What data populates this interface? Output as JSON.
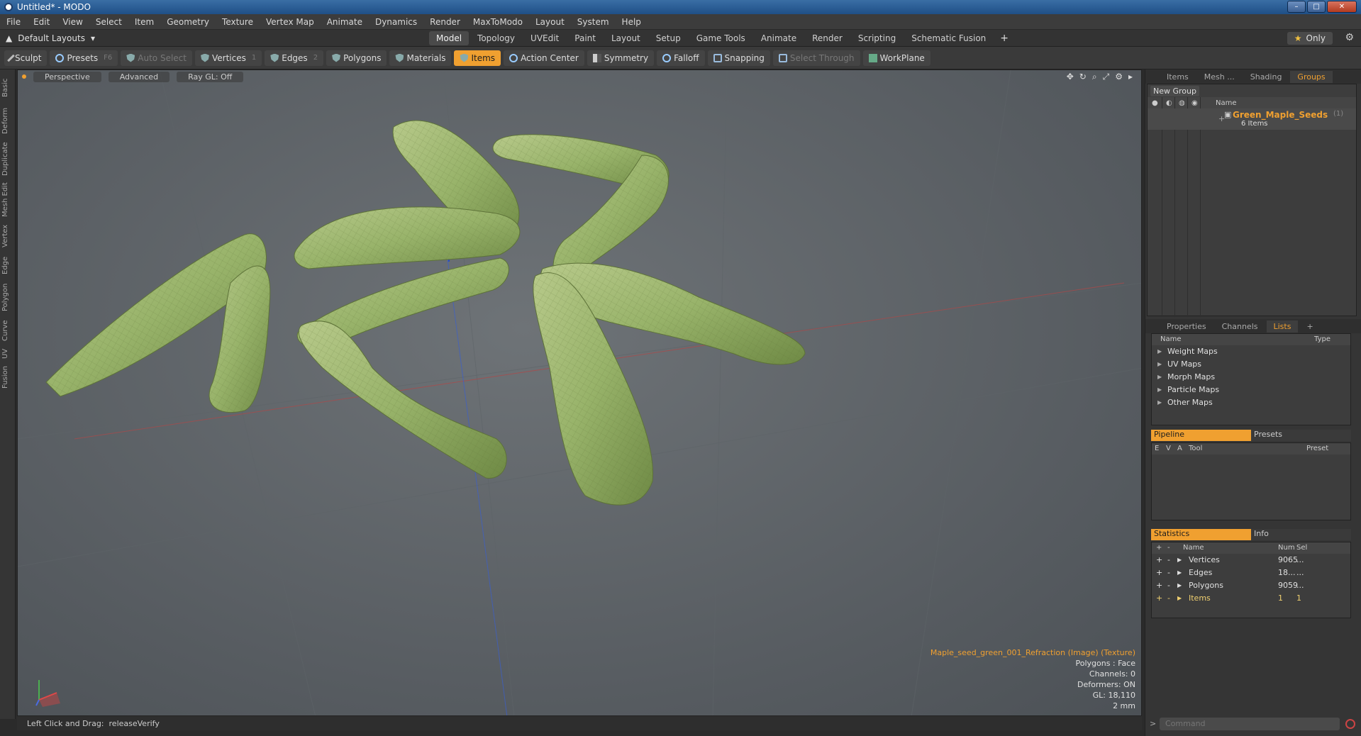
{
  "window": {
    "title": "Untitled* - MODO"
  },
  "menu": [
    "File",
    "Edit",
    "View",
    "Select",
    "Item",
    "Geometry",
    "Texture",
    "Vertex Map",
    "Animate",
    "Dynamics",
    "Render",
    "MaxToModo",
    "Layout",
    "System",
    "Help"
  ],
  "layout": {
    "dropdown": "Default Layouts",
    "tabs": [
      "Model",
      "Topology",
      "UVEdit",
      "Paint",
      "Layout",
      "Setup",
      "Game Tools",
      "Animate",
      "Render",
      "Scripting",
      "Schematic Fusion"
    ],
    "active_tab": "Model",
    "only_label": "Only"
  },
  "toolbar": {
    "sculpt": "Sculpt",
    "presets": "Presets",
    "presets_key": "F6",
    "auto_select": "Auto Select",
    "vertices": "Vertices",
    "vertices_key": "1",
    "edges": "Edges",
    "edges_key": "2",
    "polygons": "Polygons",
    "materials": "Materials",
    "items": "Items",
    "action_center": "Action Center",
    "symmetry": "Symmetry",
    "falloff": "Falloff",
    "snapping": "Snapping",
    "select_through": "Select Through",
    "workplane": "WorkPlane"
  },
  "left_tabs": [
    "Basic",
    "Deform",
    "Duplicate",
    "Mesh Edit",
    "Vertex",
    "Edge",
    "Polygon",
    "Curve",
    "UV",
    "Fusion"
  ],
  "viewport": {
    "view": "Perspective",
    "advanced": "Advanced",
    "raygl": "Ray GL: Off",
    "info": {
      "texture": "Maple_seed_green_001_Refraction (Image) (Texture)",
      "polygons": "Polygons : Face",
      "channels": "Channels: 0",
      "deformers": "Deformers: ON",
      "gl": "GL: 18,110",
      "scale": "2 mm"
    }
  },
  "status": {
    "left": "Left Click and Drag:",
    "action": "releaseVerify"
  },
  "right_panel": {
    "top_tabs": [
      "Items",
      "Mesh ...",
      "Shading",
      "Groups"
    ],
    "active_top_tab": "Groups",
    "new_group": "New Group",
    "name_header": "Name",
    "group_name": "Green_Maple_Seeds",
    "group_count_dim": "(1)",
    "group_items": "6 Items",
    "props_tabs": [
      "Properties",
      "Channels",
      "Lists"
    ],
    "active_props_tab": "Lists",
    "lists_header": {
      "name": "Name",
      "type": "Type"
    },
    "lists": [
      "Weight Maps",
      "UV Maps",
      "Morph Maps",
      "Particle Maps",
      "Other Maps"
    ],
    "pipeline_tab": "Pipeline",
    "presets_tab": "Presets",
    "pipeline_header": {
      "e": "E",
      "v": "V",
      "a": "A",
      "tool": "Tool",
      "preset": "Preset"
    },
    "stats_tab": "Statistics",
    "info_tab": "Info",
    "stats_header": {
      "name": "Name",
      "num": "Num",
      "sel": "Sel"
    },
    "stats": [
      {
        "name": "Vertices",
        "num": "9065",
        "sel": "..."
      },
      {
        "name": "Edges",
        "num": "18...",
        "sel": "..."
      },
      {
        "name": "Polygons",
        "num": "9059",
        "sel": "..."
      },
      {
        "name": "Items",
        "num": "1",
        "sel": "1"
      }
    ],
    "command_placeholder": "Command"
  }
}
